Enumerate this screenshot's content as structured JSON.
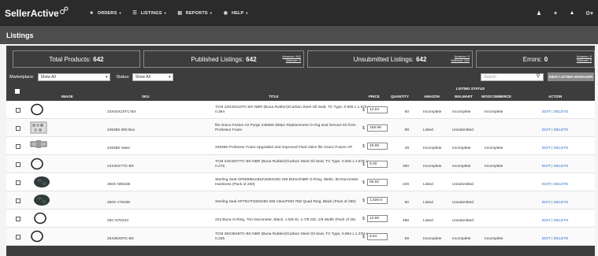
{
  "nav": {
    "brand": "SellerActive",
    "items": [
      {
        "label": "ORDERS",
        "icon": "truck-icon"
      },
      {
        "label": "LISTINGS",
        "icon": "list-icon"
      },
      {
        "label": "REPORTS",
        "icon": "bar-chart-icon"
      },
      {
        "label": "HELP",
        "icon": "lifebuoy-icon"
      }
    ],
    "right_icons": [
      "user-icon",
      "wrench-icon",
      "bell-icon",
      "gear-icon"
    ]
  },
  "page_title": "Listings",
  "stats": {
    "total_label": "Total Products:",
    "total_value": "642",
    "published_label": "Published Listings:",
    "published_value": "642",
    "published_amazon": "Amazon: 642",
    "published_walmart": "Walmart: 0",
    "unsubmitted_label": "Unsubmitted Listings:",
    "unsubmitted_value": "642",
    "unsubmitted_amazon": "Amazon: 0",
    "unsubmitted_walmart": "Walmart: 642",
    "errors_label": "Errors:",
    "errors_value": "0",
    "errors_amazon": "Amazon: 0",
    "errors_walmart": "Walmart: 0"
  },
  "filters": {
    "marketplace_label": "Marketplace:",
    "marketplace_value": "Show All",
    "status_label": "Status:",
    "status_value": "Show All",
    "search_placeholder": "Search",
    "ebay_button": "EBAY LISTING MANAGER"
  },
  "table": {
    "headers": {
      "image": "IMAGE",
      "sku": "SKU",
      "title": "TITLE",
      "price": "PRICE",
      "quantity": "QUANTITY",
      "listing_status": "LISTING STATUS",
      "amazon": "AMAZON",
      "walmart": "WALMART",
      "woocommerce": "WOOCOMMERCE",
      "action": "ACTION"
    },
    "rows": [
      {
        "sku": "23X40X10TC-BX",
        "title1": "TCM 23X40X10TC-BX NBR (Buna Rubber)/Carbon Steel Oil Seal, TC Type, 0.906 x 1.575 x",
        "title2": "0.394",
        "price": "12.54",
        "qty": "60",
        "amazon": "Incomplete",
        "walmart": "Incomplete",
        "woo": "Incomplete",
        "edit": "EDIT",
        "delete": "DELETE",
        "img": "oring-icon"
      },
      {
        "sku": "246355-300 Box",
        "title1": "fits Graco Fusion Air Purge 246355 300pc Replacement O-ring seal Service Kit from",
        "title2": "Professor Foam",
        "price": "168.99",
        "qty": "98",
        "amazon": "Listed",
        "walmart": "Unsubmitted",
        "woo": "",
        "edit": "EDIT",
        "delete": "DELETE",
        "img": "kit-box-icon"
      },
      {
        "sku": "246356 Valve",
        "title1": "246356 Professor Foam Upgraded and Improved Fluid Valve fits Graco Fusion AP",
        "title2": "",
        "price": "49.98",
        "qty": "49",
        "amazon": "Incomplete",
        "walmart": "Incomplete",
        "woo": "Incomplete",
        "edit": "EDIT",
        "delete": "DELETE",
        "img": "valve-icon"
      },
      {
        "sku": "24X40X7TC-BX",
        "title1": "TCM 24X40X7TC-BX NBR (Buna Rubber)/Carbon Steel Oil Seal, TC Type, 0.945 x 1.575 x",
        "title2": "0.276",
        "price": "5.00",
        "qty": "290",
        "amazon": "Incomplete",
        "walmart": "Incomplete",
        "woo": "Incomplete",
        "edit": "EDIT",
        "delete": "DELETE",
        "img": "oring-icon"
      },
      {
        "sku": "250X N90336",
        "title1": "Sterling Seal ORN90BLKBUN336X250 336 BUNA/NBR O-Ring, Nitrile, 90 Durometer",
        "title2": "Hardness (Pack of 250)",
        "price": "65.50",
        "qty": "100",
        "amazon": "Listed",
        "walmart": "Unsubmitted",
        "woo": "",
        "edit": "EDIT",
        "delete": "DELETE",
        "img": "oring-pile-icon"
      },
      {
        "sku": "250X V75336",
        "title1": "Sterling Seal XP75VIT336X250 336 Viton/FKM 75D Quad Ring, Black (Pack of 250)",
        "title2": "",
        "price": "1,826.6",
        "qty": "50",
        "amazon": "Listed",
        "walmart": "Unsubmitted",
        "woo": "",
        "edit": "EDIT",
        "delete": "DELETE",
        "img": "oring-pile-icon"
      },
      {
        "sku": "25C N70223",
        "title1": "223 Buna O-Ring, 70A Durometer, Black, 1-5/8 ID, 1-7/8 OD, 1/8 Width (Pack of 25)",
        "title2": "",
        "price": "13.99",
        "qty": "496",
        "amazon": "Listed",
        "walmart": "Unsubmitted",
        "woo": "",
        "edit": "EDIT",
        "delete": "DELETE",
        "img": "oring-icon"
      },
      {
        "sku": "25X35X6TC-BX",
        "title1": "TCM 25X35X6TC-BX NBR (Buna Rubber)/Carbon Steel Oil Seal, TC Type, 0.984 x 1.378 x",
        "title2": "0.236",
        "price": "8.64",
        "qty": "59",
        "amazon": "Incomplete",
        "walmart": "Incomplete",
        "woo": "Incomplete",
        "edit": "EDIT",
        "delete": "DELETE",
        "img": "oring-icon"
      }
    ]
  }
}
